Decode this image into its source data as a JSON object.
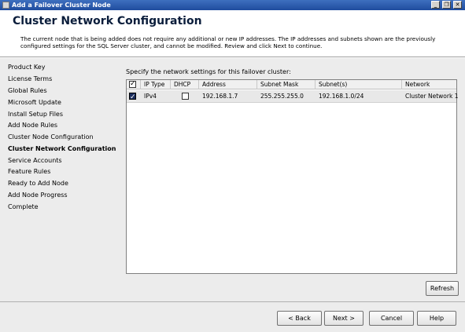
{
  "window": {
    "title": "Add a Failover Cluster Node",
    "controls": {
      "minimize": "_",
      "maximize": "❐",
      "close": "✕"
    }
  },
  "header": {
    "title": "Cluster Network Configuration",
    "description": "The current node that is being added does not require any additional or new IP addresses.  The IP addresses and subnets shown are the previously configured settings for the SQL Server cluster, and cannot be modified. Review and click Next to continue."
  },
  "nav": {
    "items": [
      {
        "label": "Product Key",
        "active": false
      },
      {
        "label": "License Terms",
        "active": false
      },
      {
        "label": "Global Rules",
        "active": false
      },
      {
        "label": "Microsoft Update",
        "active": false
      },
      {
        "label": "Install Setup Files",
        "active": false
      },
      {
        "label": "Add Node Rules",
        "active": false
      },
      {
        "label": "Cluster Node Configuration",
        "active": false
      },
      {
        "label": "Cluster Network Configuration",
        "active": true
      },
      {
        "label": "Service Accounts",
        "active": false
      },
      {
        "label": "Feature Rules",
        "active": false
      },
      {
        "label": "Ready to Add Node",
        "active": false
      },
      {
        "label": "Add Node Progress",
        "active": false
      },
      {
        "label": "Complete",
        "active": false
      }
    ]
  },
  "main": {
    "prompt": "Specify the network settings for this failover cluster:",
    "grid": {
      "headers": {
        "iptype": "IP Type",
        "dhcp": "DHCP",
        "address": "Address",
        "mask": "Subnet Mask",
        "subnets": "Subnet(s)",
        "network": "Network"
      },
      "rows": [
        {
          "selected": true,
          "iptype": "IPv4",
          "dhcp": false,
          "address": "192.168.1.7",
          "mask": "255.255.255.0",
          "subnets": "192.168.1.0/24",
          "network": "Cluster Network 1"
        }
      ]
    },
    "refresh_label": "Refresh"
  },
  "footer": {
    "back_label": "< Back",
    "next_label": "Next >",
    "cancel_label": "Cancel",
    "help_label": "Help"
  }
}
